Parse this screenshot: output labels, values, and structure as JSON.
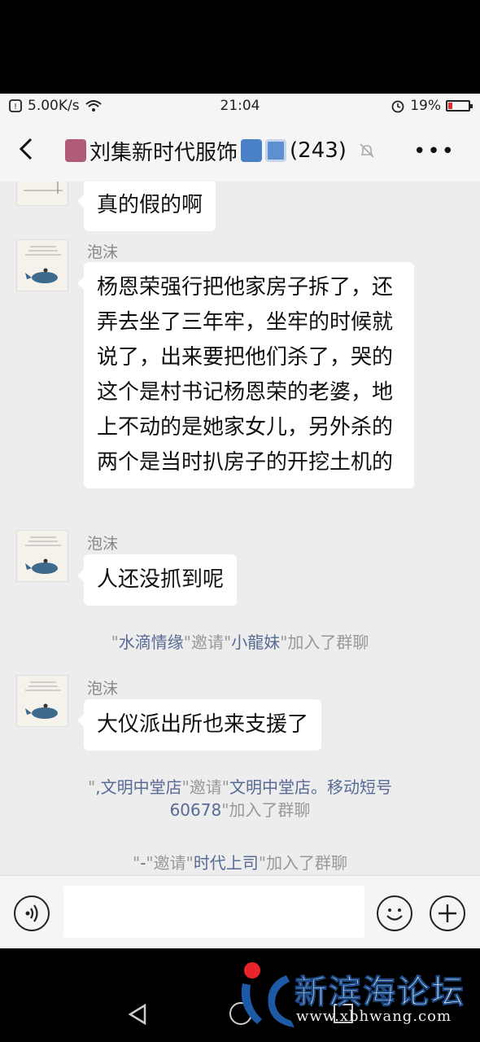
{
  "status_bar": {
    "speed": "5.00K/s",
    "time": "21:04",
    "battery": "19%",
    "battery_level": 0.19
  },
  "header": {
    "group_name": "刘集新时代服饰",
    "member_count": "(243)"
  },
  "messages": [
    {
      "type": "partial",
      "text": "真的假的啊"
    },
    {
      "type": "text",
      "sender": "泡沫",
      "text": "杨恩荣强行把他家房子拆了，还弄去坐了三年牢，坐牢的时候就说了，出来要把他们杀了，哭的这个是村书记杨恩荣的老婆，地上不动的是她家女儿，另外杀的两个是当时扒房子的开挖土机的"
    },
    {
      "type": "text",
      "sender": "泡沫",
      "text": "人还没抓到呢"
    },
    {
      "type": "system",
      "q1": "\"",
      "inviter": "水滴情缘",
      "mid": "\"邀请\"",
      "invitee": "小龍妹",
      "tail": "\"加入了群聊"
    },
    {
      "type": "text",
      "sender": "泡沫",
      "text": "大仪派出所也来支援了"
    },
    {
      "type": "system",
      "q1": "\"",
      "inviter": ",文明中堂店",
      "mid": "\"邀请\"",
      "invitee": "文明中堂店。移动短号60678",
      "tail": "\"加入了群聊"
    },
    {
      "type": "system",
      "q1": "\"",
      "inviter": "-",
      "mid": "\"邀请\"",
      "invitee": "时代上司",
      "tail": "\"加入了群聊"
    }
  ],
  "watermark": {
    "name": "新滨海论坛",
    "url": "www.xbhwang.com"
  },
  "colors": {
    "link": "#576b95",
    "background": "#ededed",
    "bubble": "#ffffff"
  }
}
